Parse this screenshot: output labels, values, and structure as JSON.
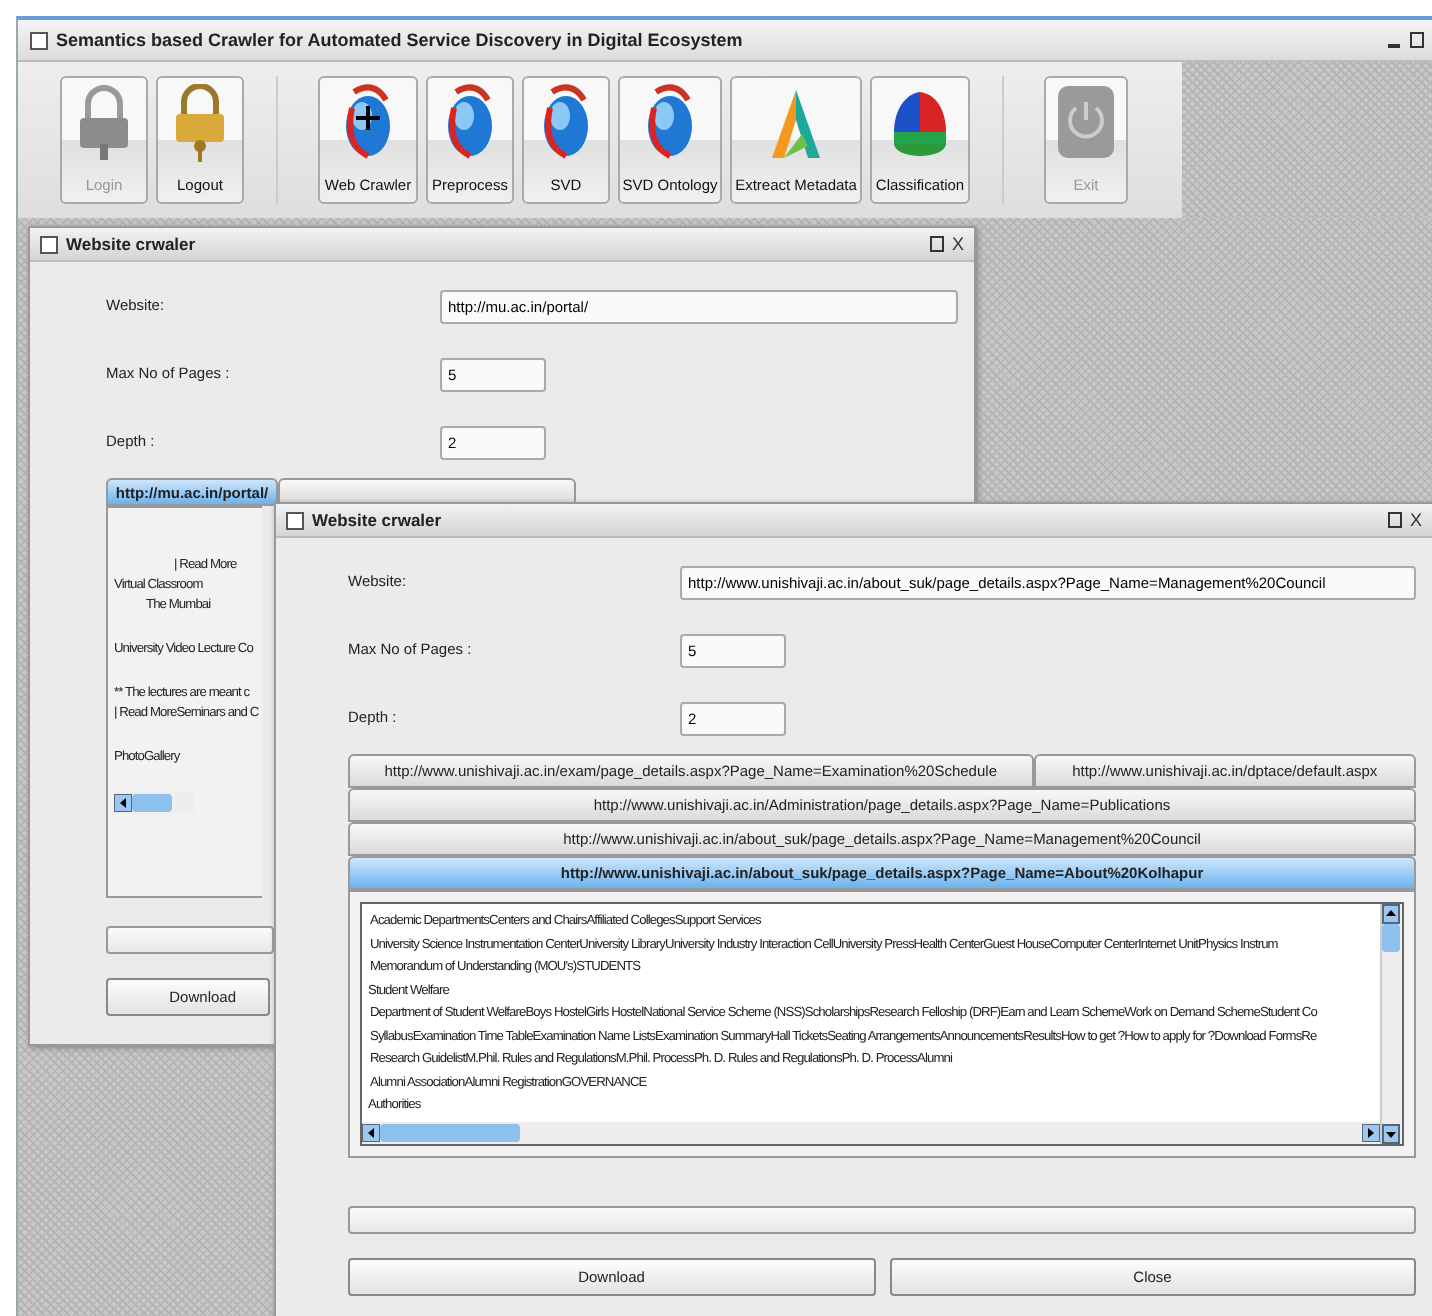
{
  "window": {
    "title": "Semantics based Crawler for Automated Service Discovery in Digital Ecosystem"
  },
  "toolbar": {
    "groups": [
      [
        {
          "label": "Login",
          "kind": "lock",
          "disabled": true
        },
        {
          "label": "Logout",
          "kind": "lock",
          "disabled": false
        }
      ],
      [
        {
          "label": "Web Crawler",
          "kind": "globeplus",
          "disabled": false
        },
        {
          "label": "Preprocess",
          "kind": "globe",
          "disabled": false
        },
        {
          "label": "SVD",
          "kind": "globe",
          "disabled": false
        },
        {
          "label": "SVD Ontology",
          "kind": "globe",
          "disabled": false
        },
        {
          "label": "Extreact Metadata",
          "kind": "triangle",
          "disabled": false
        },
        {
          "label": "Classification",
          "kind": "pie",
          "disabled": false
        }
      ],
      [
        {
          "label": "Exit",
          "kind": "power",
          "disabled": true
        }
      ]
    ]
  },
  "windows": [
    {
      "title": "Website crwaler",
      "close": "X",
      "fields": [
        {
          "label": "Website:",
          "value": "http://mu.ac.in/portal/",
          "kind": "wide"
        },
        {
          "label": "Max No of Pages :",
          "value": "5",
          "kind": "short"
        },
        {
          "label": "Depth :",
          "value": "2",
          "kind": "short"
        }
      ],
      "tab_rows": [
        [
          {
            "label": "http://mu.ac.in/portal/",
            "selected": true
          },
          {
            "selected": false
          }
        ]
      ],
      "content": [
        [
          {
            "text": "| Read More",
            "kind": "indented"
          },
          {
            "text": "Virtual Classroom",
            "kind": "plain"
          },
          {
            "text": "The Mumbai",
            "kind": "indented"
          }
        ],
        [
          {
            "text": "University Video Lecture Co",
            "kind": "plain"
          }
        ],
        [
          {
            "text": "** The lectures are meant c",
            "kind": "plain"
          },
          {
            "text": "| Read MoreSeminars and C",
            "kind": "plain"
          }
        ],
        [
          {
            "text": "PhotoGallery",
            "kind": "plain"
          }
        ]
      ],
      "progress": {
        "level": 0
      },
      "buttons": [
        "Download"
      ]
    },
    {
      "title": "Website crwaler",
      "close": "X",
      "fields": [
        {
          "label": "Website:",
          "value": "http://www.unishivaji.ac.in/about_suk/page_details.aspx?Page_Name=Management%20Council",
          "kind": "wide"
        },
        {
          "label": "Max No of Pages :",
          "value": "5",
          "kind": "short"
        },
        {
          "label": "Depth :",
          "value": "2",
          "kind": "short"
        }
      ],
      "tab_rows": [
        [
          {
            "label": "http://www.unishivaji.ac.in/exam/page_details.aspx?Page_Name=Examination%20Schedule",
            "selected": false
          },
          {
            "label": "http://www.unishivaji.ac.in/dptace/default.aspx",
            "selected": false
          }
        ],
        [
          {
            "label": "http://www.unishivaji.ac.in/Administration/page_details.aspx?Page_Name=Publications",
            "selected": false
          }
        ],
        [
          {
            "label": "http://www.unishivaji.ac.in/about_suk/page_details.aspx?Page_Name=Management%20Council",
            "selected": false
          }
        ],
        [
          {
            "label": "http://www.unishivaji.ac.in/about_suk/page_details.aspx?Page_Name=About%20Kolhapur",
            "selected": true
          }
        ]
      ],
      "content": [
        [
          {
            "text": "Academic DepartmentsCenters and ChairsAffiliated CollegesSupport Services",
            "kind": "indented"
          },
          {
            "text": "University Science Instrumentation CenterUniversity LibraryUniversity Industry Interaction CellUniversity PressHealth CenterGuest HouseComputer CenterInternet UnitPhysics Instrum",
            "kind": "indented"
          },
          {
            "text": "Memorandum of Understanding (MOU's)STUDENTS",
            "kind": "indented"
          },
          {
            "text": "Student Welfare",
            "kind": "plain"
          },
          {
            "text": "Department of Student WelfareBoys HostelGirls HostelNational Service Scheme (NSS)ScholarshipsResearch Felloship (DRF)Earn and Learn SchemeWork on Demand SchemeStudent Co",
            "kind": "indented"
          },
          {
            "text": "SyllabusExamination Time TableExamination Name ListsExamination SummaryHall TicketsSeating ArrangementsAnnouncementsResultsHow to get ?How to apply for ?Download FormsRe",
            "kind": "indented"
          },
          {
            "text": "Research GuidelistM.Phil. Rules and RegulationsM.Phil. ProcessPh. D. Rules and RegulationsPh. D. ProcessAlumni",
            "kind": "indented"
          },
          {
            "text": "Alumni AssociationAlumni RegistrationGOVERNANCE",
            "kind": "indented"
          },
          {
            "text": "Authorities",
            "kind": "plain"
          }
        ]
      ],
      "progress": {
        "level": 0
      },
      "buttons": [
        "Download",
        "Close"
      ]
    }
  ]
}
